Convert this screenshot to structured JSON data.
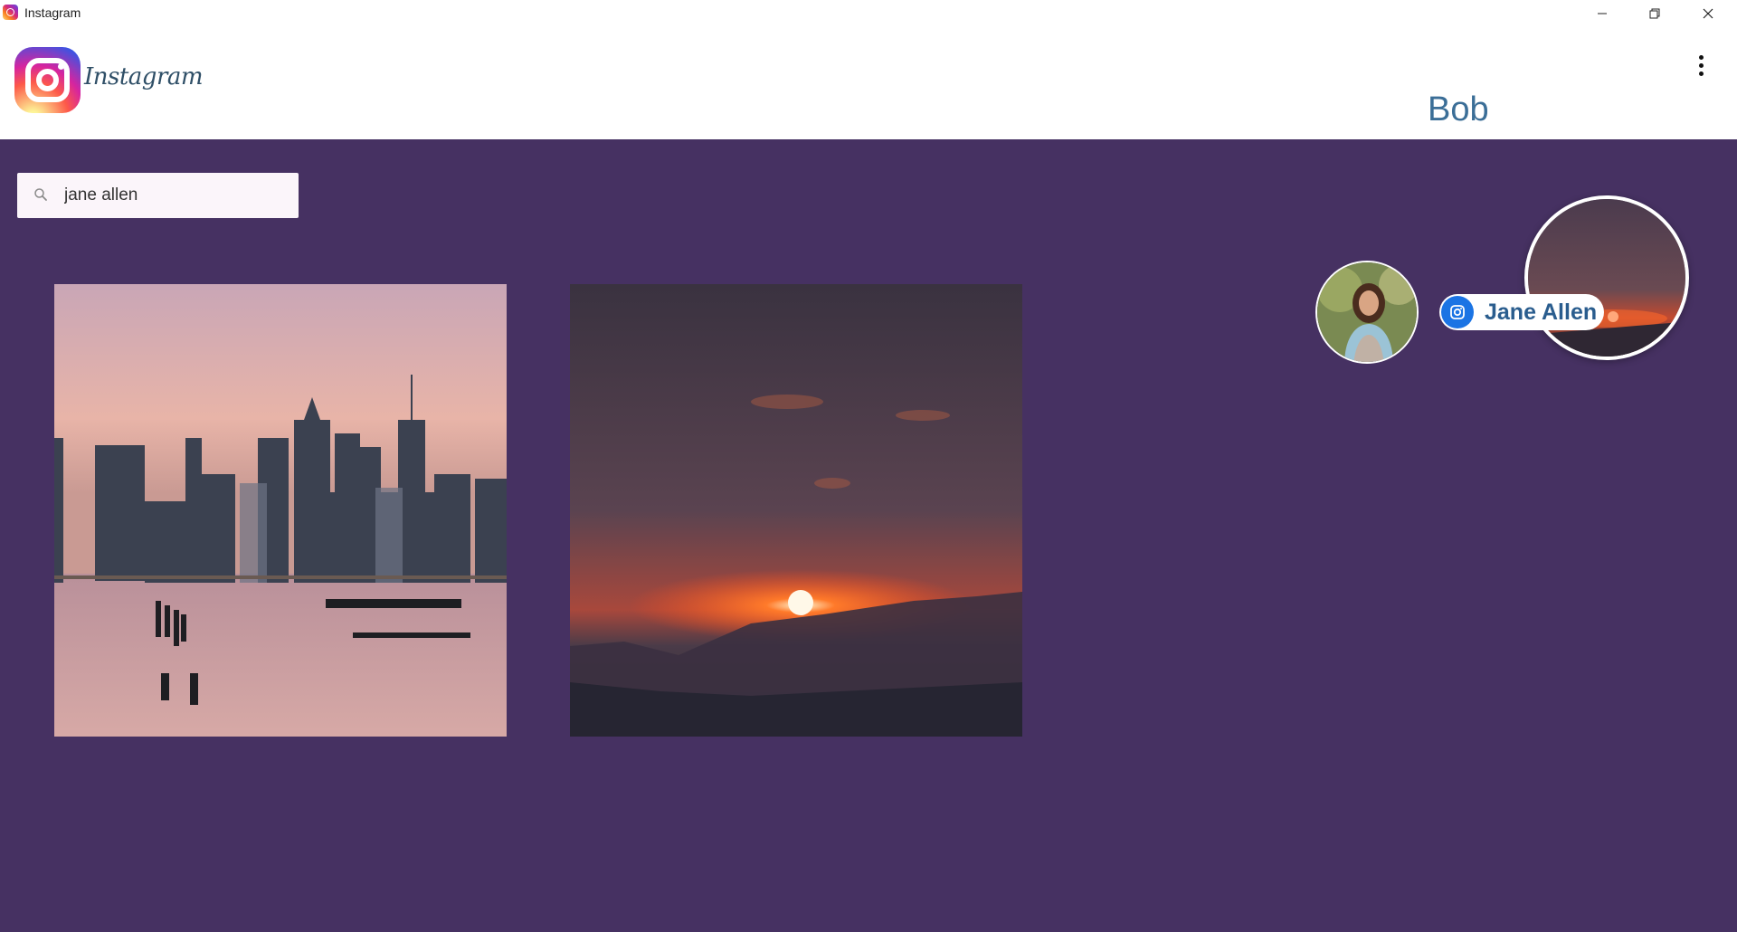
{
  "window": {
    "title": "Instagram",
    "controls": {
      "minimize": "minimize",
      "restore": "restore",
      "close": "close"
    }
  },
  "header": {
    "logo_text": "Instagram",
    "username": "Bob"
  },
  "search": {
    "value": "jane allen",
    "placeholder": ""
  },
  "posts": [
    {
      "id": "post-1",
      "subject": "city skyline at dusk"
    },
    {
      "id": "post-2",
      "subject": "sunset over mountains"
    }
  ],
  "search_result": {
    "name": "Jane Allen"
  },
  "colors": {
    "background": "#463162",
    "accent": "#3b6e97",
    "chip_icon": "#1b74e4"
  }
}
